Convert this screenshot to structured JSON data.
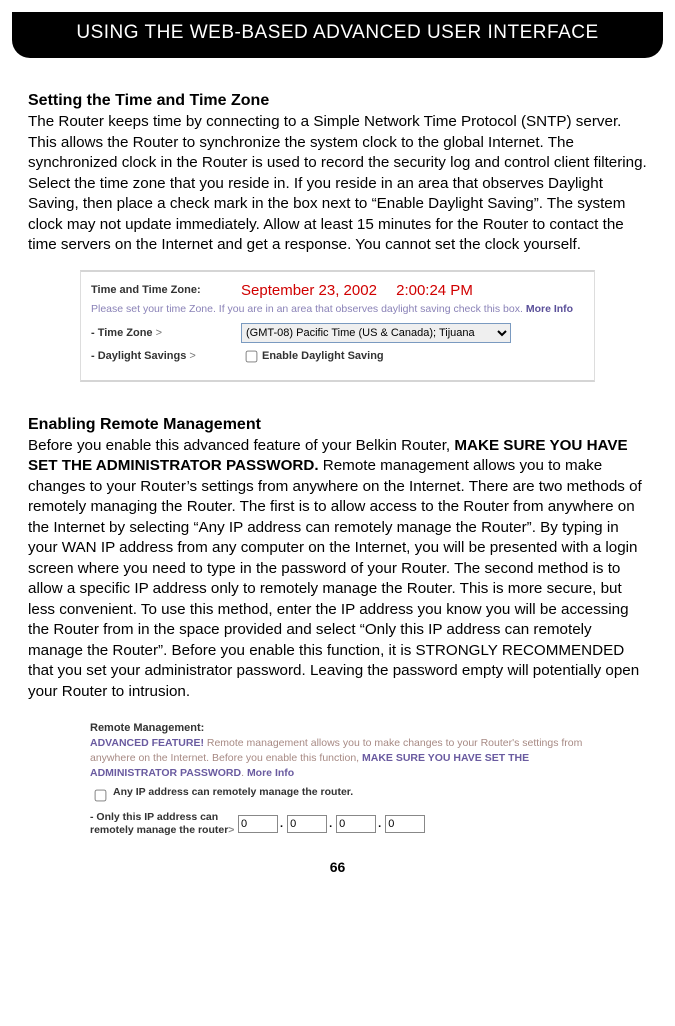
{
  "header": {
    "title": "USING THE WEB-BASED ADVANCED USER INTERFACE"
  },
  "section1": {
    "title": "Setting the Time and Time Zone",
    "body": "The Router keeps time by connecting to a Simple Network Time Protocol (SNTP) server. This allows the Router to synchronize the system clock to the global Internet. The synchronized clock in the Router is used to record the security log and control client filtering. Select the time zone that you reside in. If you reside in an area that observes Daylight Saving, then place a check mark in the box next to “Enable Daylight Saving”. The system clock may not update immediately. Allow at least 15 minutes for the Router to contact the time servers on the Internet and get a response. You cannot set the clock yourself."
  },
  "timePanel": {
    "rowLabel": "Time and Time Zone:",
    "datetime": "September 23, 2002  2:00:24 PM",
    "helper": "Please set your time Zone. If you are in an area that observes daylight saving check this box.",
    "moreInfo": "More Info",
    "tzLabel": "- Time Zone",
    "tzValue": "(GMT-08) Pacific Time (US & Canada); Tijuana",
    "dlsLabel": "- Daylight Savings",
    "dlsCheckbox": "Enable Daylight Saving"
  },
  "section2": {
    "title": "Enabling Remote Management",
    "body_pre": "Before you enable this advanced feature of your Belkin Router, ",
    "body_bold": "MAKE SURE YOU HAVE SET THE ADMINISTRATOR PASSWORD.",
    "body_post": " Remote management allows you to make changes to your Router’s settings from anywhere on the Internet. There are two methods of remotely managing the Router. The first is to allow access to the Router from anywhere on the Internet by selecting “Any IP address can remotely manage the Router”. By typing in your WAN IP address from any computer on the Internet, you will be presented with a login screen where you need to type in the password of your Router. The second method is to allow a specific IP address only to remotely manage the Router. This is more secure, but less convenient. To use this method, enter the IP address you know you will be accessing the Router from in the space provided and select “Only this IP address can remotely manage the Router”. Before you enable this function, it is STRONGLY RECOMMENDED that you set your administrator password. Leaving the password empty will potentially open your Router to intrusion."
  },
  "remotePanel": {
    "title": "Remote Management:",
    "advLead": "ADVANCED FEATURE!",
    "advBody": " Remote management allows you to make changes to your Router's settings from anywhere on the Internet. Before you enable this function, ",
    "advBold2": "MAKE SURE YOU HAVE SET THE ADMINISTRATOR PASSWORD",
    "advPeriod": ". ",
    "moreInfo": "More Info",
    "opt1": "Any IP address can remotely manage the router.",
    "opt2": "- Only this IP address can remotely manage the router",
    "ip": {
      "a": "0",
      "b": "0",
      "c": "0",
      "d": "0"
    }
  },
  "pageNumber": "66"
}
